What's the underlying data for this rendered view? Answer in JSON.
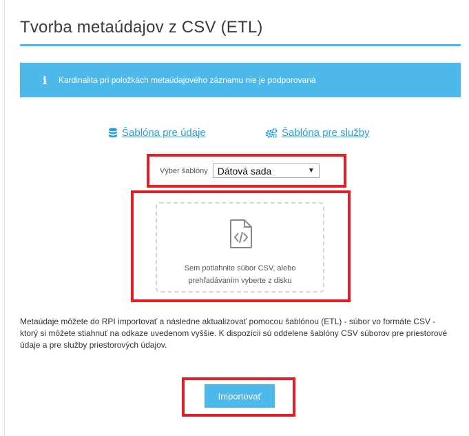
{
  "page": {
    "title": "Tvorba metaúdajov z CSV (ETL)"
  },
  "info": {
    "icon": "info-icon",
    "text": "Kardinalita pri položkách metaúdajového záznamu nie je podporovaná"
  },
  "templates": {
    "data_link": {
      "icon": "database-icon",
      "label": "Šablóna pre údaje"
    },
    "services_link": {
      "icon": "gears-icon",
      "label": "Šablóna pre služby"
    }
  },
  "template_select": {
    "label": "Výber šablóny",
    "selected": "Dátová sada"
  },
  "dropzone": {
    "icon": "code-file-icon",
    "line1": "Sem potiahnite súbor CSV, alebo",
    "line2": "prehľadávaním vyberte z disku"
  },
  "description": "Metaúdaje môžete do RPI importovať a následne aktualizovať pomocou šablónou (ETL) - súbor vo formáte CSV - ktorý si môžete stiahnuť na odkaze uvedenom vyššie. K dispozícii sú oddelene šablóny CSV súborov pre priestorové údaje a pre služby priestorových údajov.",
  "actions": {
    "import_label": "Importovať"
  },
  "colors": {
    "accent": "#4db8ea",
    "link": "#2a9fd6",
    "highlight": "#e31e24"
  }
}
